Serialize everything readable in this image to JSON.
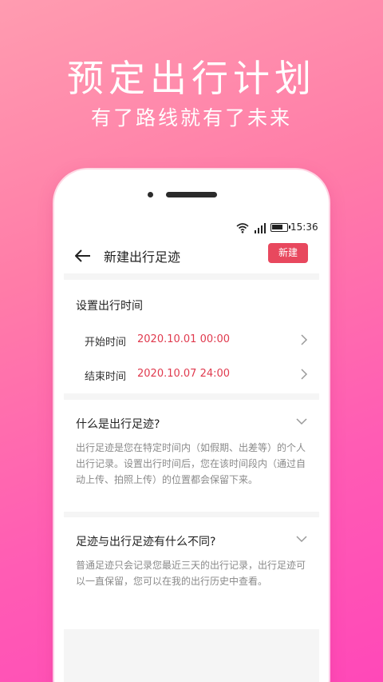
{
  "hero": {
    "title": "预定出行计划",
    "subtitle": "有了路线就有了未来"
  },
  "status_bar": {
    "time": "15:36"
  },
  "nav": {
    "back_icon": "back-arrow-icon",
    "title": "新建出行足迹",
    "new_label": "新建"
  },
  "time_settings": {
    "title": "设置出行时间",
    "rows": [
      {
        "label": "开始时间",
        "value": "2020.10.01 00:00"
      },
      {
        "label": "结束时间",
        "value": "2020.10.07 24:00"
      }
    ]
  },
  "faq": [
    {
      "question": "什么是出行足迹?",
      "answer": "出行足迹是您在特定时间内（如假期、出差等）的个人出行记录。设置出行时间后，您在该时间段内（通过自动上传、拍照上传）的位置都会保留下来。"
    },
    {
      "question": "足迹与出行足迹有什么不同?",
      "answer": "普通足迹只会记录您最近三天的出行记录，出行足迹可以一直保留，您可以在我的出行历史中查看。"
    }
  ],
  "colors": {
    "accent": "#e8485e",
    "value_red": "#e03a4e",
    "background_gradient_start": "#ff9cb0",
    "background_gradient_end": "#ff48b8"
  }
}
